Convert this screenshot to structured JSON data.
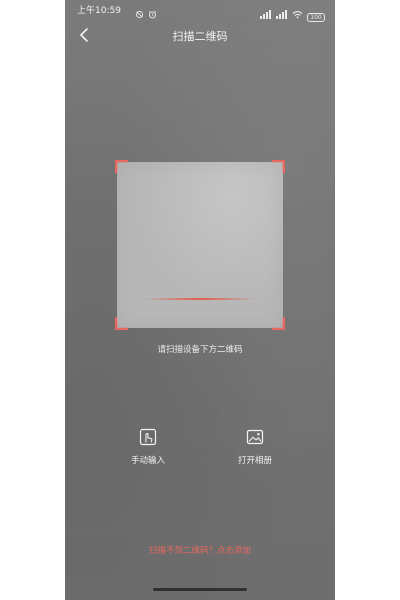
{
  "status_bar": {
    "time": "上午10:59",
    "battery": "100"
  },
  "nav": {
    "title": "扫描二维码"
  },
  "scanner": {
    "hint": "请扫描设备下方二维码"
  },
  "actions": {
    "manual_label": "手动输入",
    "album_label": "打开相册"
  },
  "bottom_link": "扫描不到二维码？点击添加",
  "colors": {
    "accent": "#e7685f",
    "background": "#747474",
    "scan_area": "#b7b7b7",
    "text": "#f2f2f2"
  },
  "icons": {
    "back": "chevron-left-icon",
    "manual": "hand-tap-icon",
    "album": "image-icon"
  }
}
